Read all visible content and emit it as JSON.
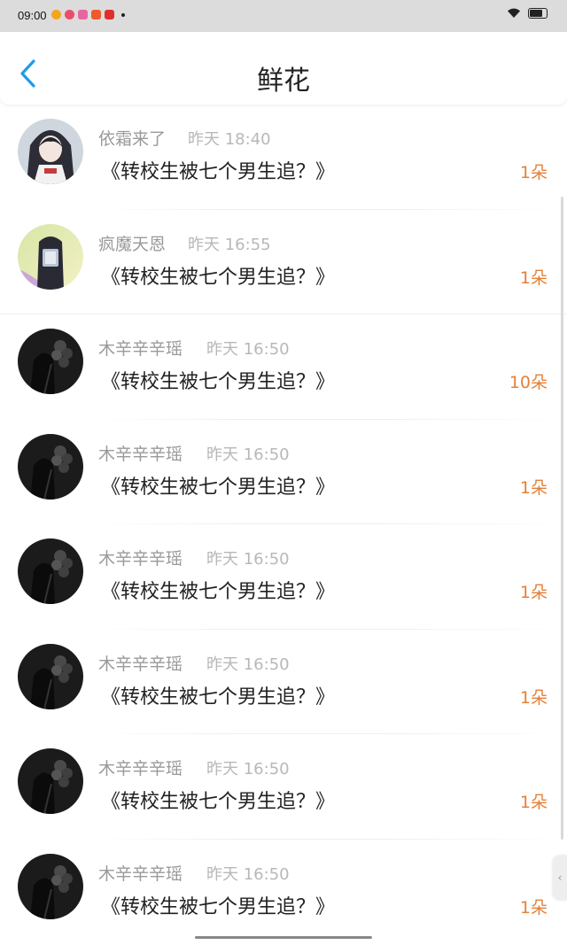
{
  "status_bar": {
    "time": "09:00",
    "notification_icons": [
      "weibo-icon",
      "app-icon",
      "app-icon",
      "app-icon",
      "douyin-icon"
    ],
    "right_icons": [
      "wifi-icon",
      "battery-icon"
    ]
  },
  "header": {
    "back_icon": "chevron-left-icon",
    "title": "鲜花"
  },
  "colors": {
    "accent_blue": "#1e9bea",
    "count_orange": "#e58038",
    "name_gray": "#9a9a9a"
  },
  "items": [
    {
      "name": "依霜来了",
      "time": "昨天 18:40",
      "book": "《转校生被七个男生追？》",
      "count": "1朵",
      "avatar": "avatar-anime"
    },
    {
      "name": "疯魔天恩",
      "time": "昨天 16:55",
      "book": "《转校生被七个男生追？》",
      "count": "1朵",
      "avatar": "avatar-photo"
    },
    {
      "name": "木辛辛辛瑶",
      "time": "昨天 16:50",
      "book": "《转校生被七个男生追？》",
      "count": "10朵",
      "avatar": "avatar-dark"
    },
    {
      "name": "木辛辛辛瑶",
      "time": "昨天 16:50",
      "book": "《转校生被七个男生追？》",
      "count": "1朵",
      "avatar": "avatar-dark"
    },
    {
      "name": "木辛辛辛瑶",
      "time": "昨天 16:50",
      "book": "《转校生被七个男生追？》",
      "count": "1朵",
      "avatar": "avatar-dark"
    },
    {
      "name": "木辛辛辛瑶",
      "time": "昨天 16:50",
      "book": "《转校生被七个男生追？》",
      "count": "1朵",
      "avatar": "avatar-dark"
    },
    {
      "name": "木辛辛辛瑶",
      "time": "昨天 16:50",
      "book": "《转校生被七个男生追？》",
      "count": "1朵",
      "avatar": "avatar-dark"
    },
    {
      "name": "木辛辛辛瑶",
      "time": "昨天 16:50",
      "book": "《转校生被七个男生追？》",
      "count": "1朵",
      "avatar": "avatar-dark"
    }
  ]
}
